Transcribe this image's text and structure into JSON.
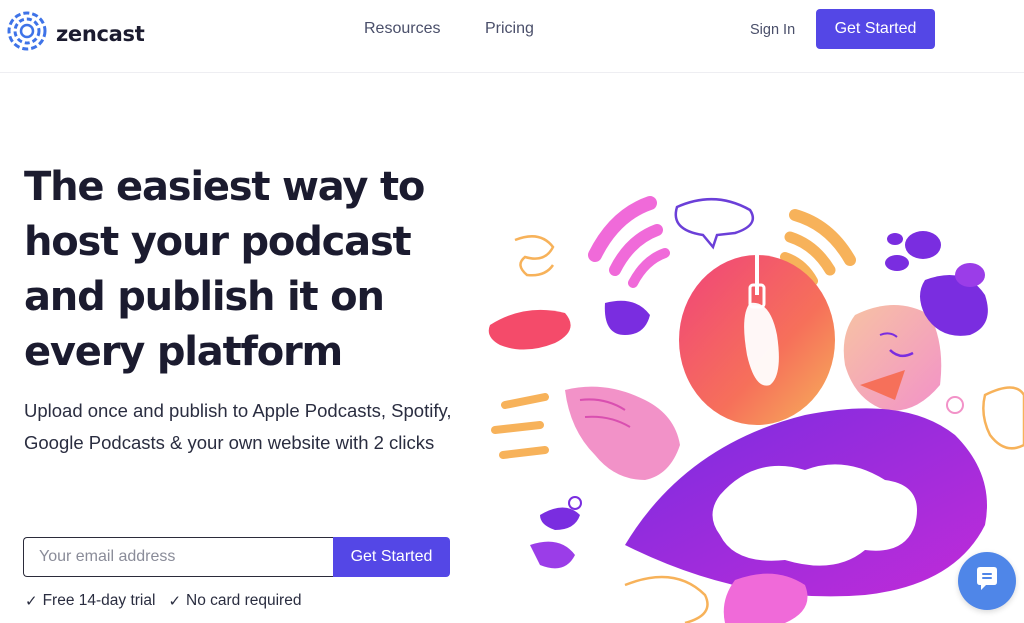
{
  "header": {
    "brand": "zencast",
    "nav": {
      "resources": "Resources",
      "pricing": "Pricing"
    },
    "sign_in": "Sign In",
    "cta": "Get Started"
  },
  "hero": {
    "title": "The easiest way to host your podcast and publish it on every platform",
    "subtitle": "Upload once and publish to Apple Podcasts, Spotify, Google Podcasts & your own website with 2 clicks",
    "email_placeholder": "Your email address",
    "submit": "Get Started",
    "perks": [
      "Free 14-day trial",
      "No card required"
    ]
  },
  "icons": {
    "logo": "zencast-logo-icon",
    "check": "check-icon",
    "chat": "chat-icon"
  },
  "colors": {
    "primary": "#5447e6",
    "heading": "#1b1b2f",
    "chat_widget": "#4f86e8",
    "logo_blue": "#3e73e8"
  }
}
